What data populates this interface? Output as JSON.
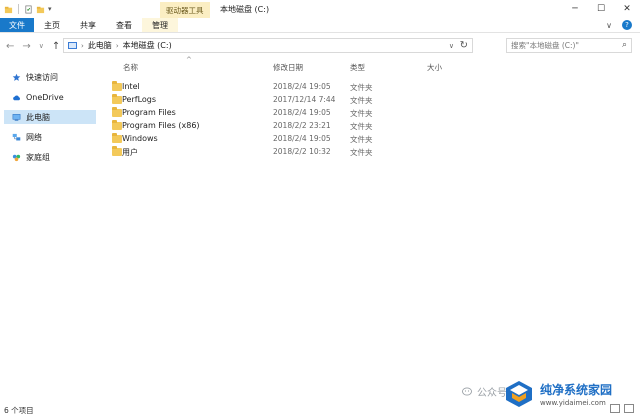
{
  "titlebar": {
    "context_tab": "驱动器工具",
    "title": "本地磁盘 (C:)",
    "pin_glyph": "▾",
    "controls": {
      "minimize": "─",
      "maximize": "☐",
      "close": "✕"
    }
  },
  "ribbon": {
    "tabs": [
      "文件",
      "主页",
      "共享",
      "查看",
      "管理"
    ],
    "expand_glyph": "∨",
    "help_glyph": "?"
  },
  "address": {
    "back": "←",
    "forward": "→",
    "recent": "∨",
    "up": "↑",
    "crumbs": [
      "此电脑",
      "本地磁盘 (C:)"
    ],
    "sep": "›",
    "dropdown": "∨",
    "refresh": "↻"
  },
  "search": {
    "placeholder": "搜索\"本地磁盘 (C:)\"",
    "icon": "⌕"
  },
  "nav": {
    "items": [
      {
        "label": "快速访问",
        "icon": "star-icon"
      },
      {
        "label": "OneDrive",
        "icon": "cloud-icon"
      },
      {
        "label": "此电脑",
        "icon": "computer-icon",
        "selected": true
      },
      {
        "label": "网络",
        "icon": "network-icon"
      },
      {
        "label": "家庭组",
        "icon": "homegroup-icon"
      }
    ]
  },
  "columns": {
    "name": "名称",
    "date": "修改日期",
    "type": "类型",
    "size": "大小",
    "sort_glyph": "^"
  },
  "files": [
    {
      "name": "Intel",
      "date": "2018/2/4 19:05",
      "type": "文件夹"
    },
    {
      "name": "PerfLogs",
      "date": "2017/12/14 7:44",
      "type": "文件夹"
    },
    {
      "name": "Program Files",
      "date": "2018/2/4 19:05",
      "type": "文件夹"
    },
    {
      "name": "Program Files (x86)",
      "date": "2018/2/2 23:21",
      "type": "文件夹"
    },
    {
      "name": "Windows",
      "date": "2018/2/4 19:05",
      "type": "文件夹"
    },
    {
      "name": "用户",
      "date": "2018/2/2 10:32",
      "type": "文件夹"
    }
  ],
  "status": {
    "count": "6 个项目"
  },
  "watermark": {
    "wechat": "公众号",
    "site_name": "纯净系统家园",
    "site_url": "www.yidaimei.com"
  },
  "colors": {
    "file_tab": "#1979ca",
    "context_tab": "#fbeec3",
    "selection": "#cce4f7",
    "folder": "#f3c95a"
  }
}
